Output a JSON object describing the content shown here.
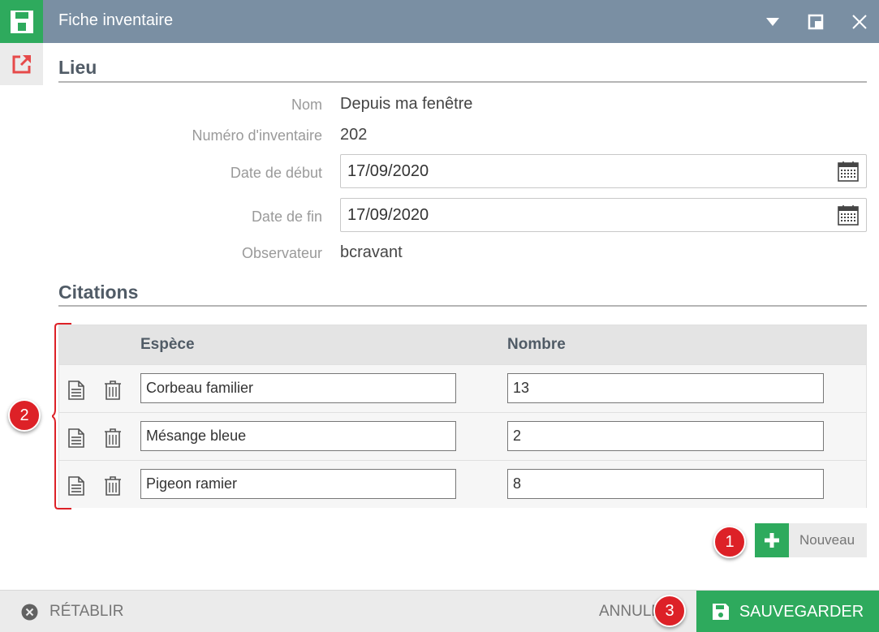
{
  "window": {
    "title": "Fiche inventaire"
  },
  "lieu": {
    "section_title": "Lieu",
    "fields": {
      "nom_label": "Nom",
      "nom_value": "Depuis ma fenêtre",
      "numero_label": "Numéro d'inventaire",
      "numero_value": "202",
      "debut_label": "Date de début",
      "debut_value": "17/09/2020",
      "fin_label": "Date de fin",
      "fin_value": "17/09/2020",
      "observateur_label": "Observateur",
      "observateur_value": "bcravant"
    }
  },
  "citations": {
    "section_title": "Citations",
    "columns": [
      "Espèce",
      "Nombre"
    ],
    "rows": [
      {
        "espece": "Corbeau familier",
        "nombre": "13"
      },
      {
        "espece": "Mésange bleue",
        "nombre": "2"
      },
      {
        "espece": "Pigeon ramier",
        "nombre": "8"
      }
    ],
    "new_label": "Nouveau"
  },
  "annotations": {
    "badge_1": "1",
    "badge_2": "2",
    "badge_3": "3"
  },
  "footer": {
    "reset_label": "RÉTABLIR",
    "cancel_label": "ANNULER",
    "save_label": "SAUVEGARDER"
  },
  "icons": {
    "app": "floppy-disk-icon",
    "side": "external-link-icon",
    "dropdown": "triangle-down-icon",
    "restore": "window-restore-icon",
    "close": "close-icon",
    "calendar": "calendar-icon",
    "row_detail": "document-icon",
    "row_delete": "trash-icon",
    "add": "plus-icon",
    "reset": "circle-x-icon",
    "save": "floppy-disk-icon"
  },
  "colors": {
    "titlebar": "#7a8fa3",
    "accent_green": "#2eaa5d",
    "annotation_red": "#dd2127",
    "section_text": "#505b66"
  }
}
